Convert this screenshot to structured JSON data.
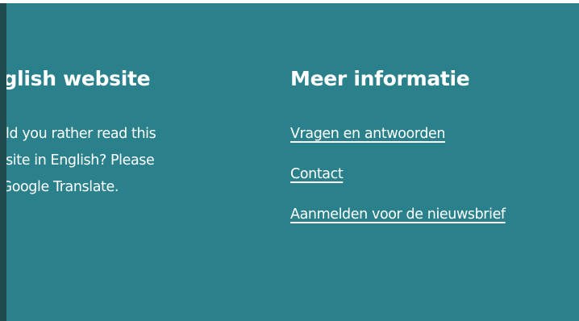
{
  "footer": {
    "english": {
      "heading": "nglish website",
      "body": "ould you rather read this ebsite in English? Please e Google Translate.",
      "line1": "ould you rather read this",
      "line2": "ebsite in English? Please",
      "line3": "e Google Translate."
    },
    "info": {
      "heading": "Meer informatie",
      "links": [
        {
          "label": "Vragen en antwoorden"
        },
        {
          "label": "Contact"
        },
        {
          "label": "Aanmelden voor de nieuwsbrief"
        }
      ]
    }
  },
  "colors": {
    "footer_background": "#2a818b",
    "left_edge": "#1f4b4e",
    "text": "#ffffff"
  }
}
